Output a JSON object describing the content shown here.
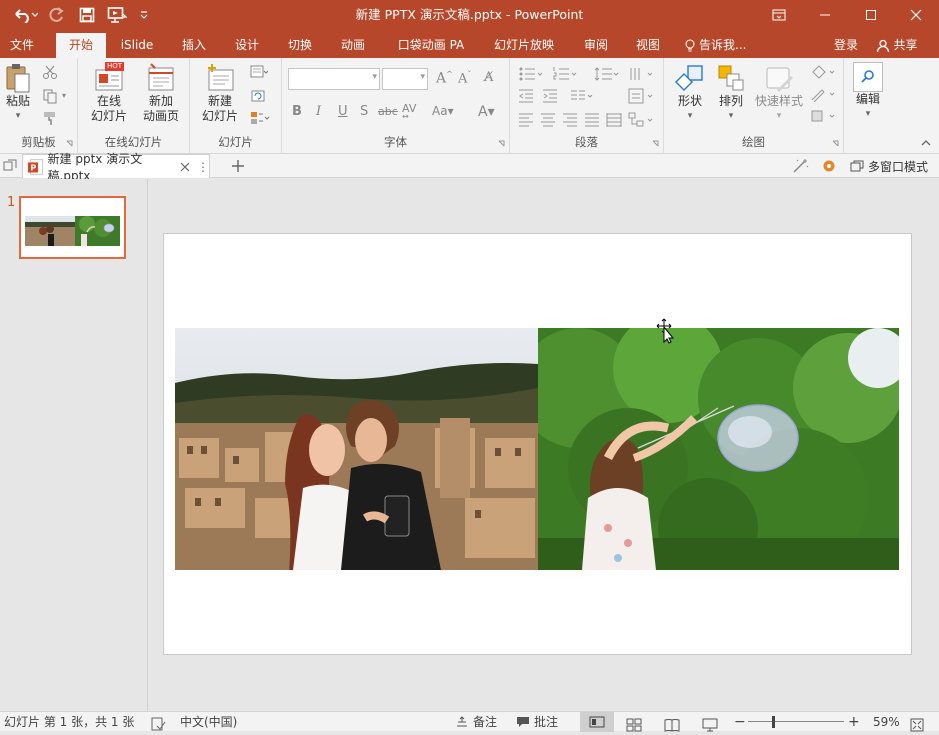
{
  "app": {
    "window_title": "新建 PPTX 演示文稿.pptx - PowerPoint",
    "accent_color": "#b7472a"
  },
  "qat": {
    "undo_icon": "undo-icon",
    "redo_icon": "redo-icon",
    "save_icon": "save-icon",
    "present_icon": "present-from-start-icon",
    "customize_icon": "customize-qat-icon"
  },
  "ribbon_tabs": [
    "文件",
    "开始",
    "iSlide",
    "插入",
    "设计",
    "切换",
    "动画",
    "口袋动画 PA",
    "幻灯片放映",
    "审阅",
    "视图"
  ],
  "active_tab": "开始",
  "tell_me": "告诉我...",
  "account": {
    "login": "登录",
    "share": "共享"
  },
  "groups": {
    "clipboard": {
      "label": "剪贴板",
      "paste": "粘贴"
    },
    "online": {
      "label": "在线幻灯片",
      "online_slides_1": "在线",
      "online_slides_2": "幻灯片",
      "new_anim_1": "新加",
      "new_anim_2": "动画页",
      "hot_badge": "HOT"
    },
    "slides": {
      "label": "幻灯片",
      "new_slide_1": "新建",
      "new_slide_2": "幻灯片"
    },
    "font": {
      "label": "字体",
      "font_name": "",
      "font_size": ""
    },
    "paragraph": {
      "label": "段落"
    },
    "drawing": {
      "label": "绘图",
      "shapes": "形状",
      "arrange": "排列",
      "quick_styles": "快速样式"
    },
    "editing": {
      "label": "编辑"
    }
  },
  "doc_tab": {
    "title": "新建 pptx 演示文稿.pptx",
    "multi_window": "多窗口模式"
  },
  "thumbnails": [
    {
      "number": "1"
    }
  ],
  "statusbar": {
    "slide_info": "幻灯片 第 1 张，共 1 张",
    "language": "中文(中国)",
    "notes": "备注",
    "comments": "批注",
    "zoom": "59%"
  }
}
